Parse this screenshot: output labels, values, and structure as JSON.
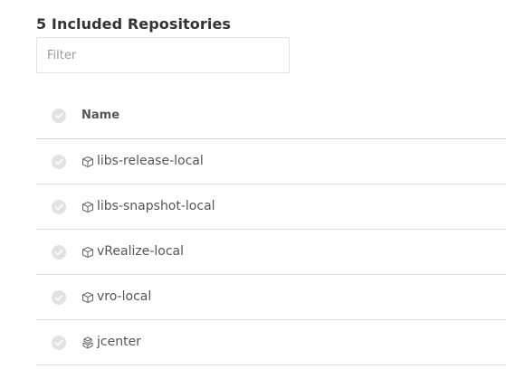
{
  "header": {
    "title": "5 Included Repositories"
  },
  "filter": {
    "placeholder": "Filter",
    "value": ""
  },
  "table": {
    "columns": [
      {
        "label": "Name"
      }
    ],
    "rows": [
      {
        "name": "libs-release-local",
        "icon": "local-repo-icon"
      },
      {
        "name": "libs-snapshot-local",
        "icon": "local-repo-icon"
      },
      {
        "name": "vRealize-local",
        "icon": "local-repo-icon"
      },
      {
        "name": "vro-local",
        "icon": "local-repo-icon"
      },
      {
        "name": "jcenter",
        "icon": "remote-repo-icon"
      }
    ]
  },
  "colors": {
    "text": "#555555",
    "title": "#333333",
    "checkbox": "#e2e2e2",
    "divider": "#dedede"
  }
}
